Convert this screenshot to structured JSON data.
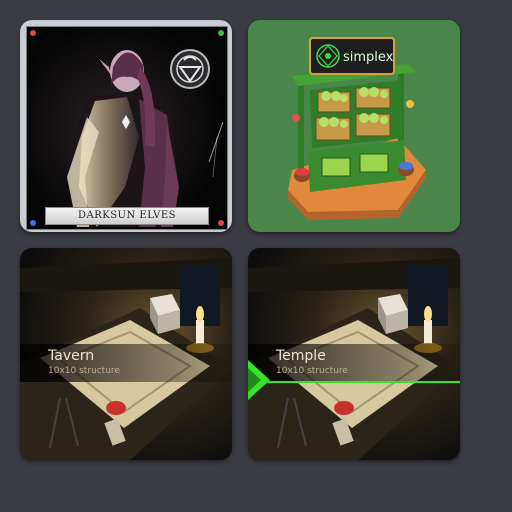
{
  "tiles": [
    {
      "kind": "card",
      "caption": "DARKSUN ELVES"
    },
    {
      "kind": "store",
      "sign_text": "simplex"
    },
    {
      "kind": "structure",
      "title": "Tavern",
      "subtitle": "10x10 structure",
      "selected": false
    },
    {
      "kind": "structure",
      "title": "Temple",
      "subtitle": "10x10 structure",
      "selected": true
    }
  ],
  "colors": {
    "background": "#3b3b43",
    "store_background": "#4a8549",
    "selection_accent": "#39e22a",
    "label_title": "#f2e6cf"
  },
  "icons": [
    "faction-emblem-icon",
    "candle-icon",
    "selection-arrow-icon"
  ]
}
